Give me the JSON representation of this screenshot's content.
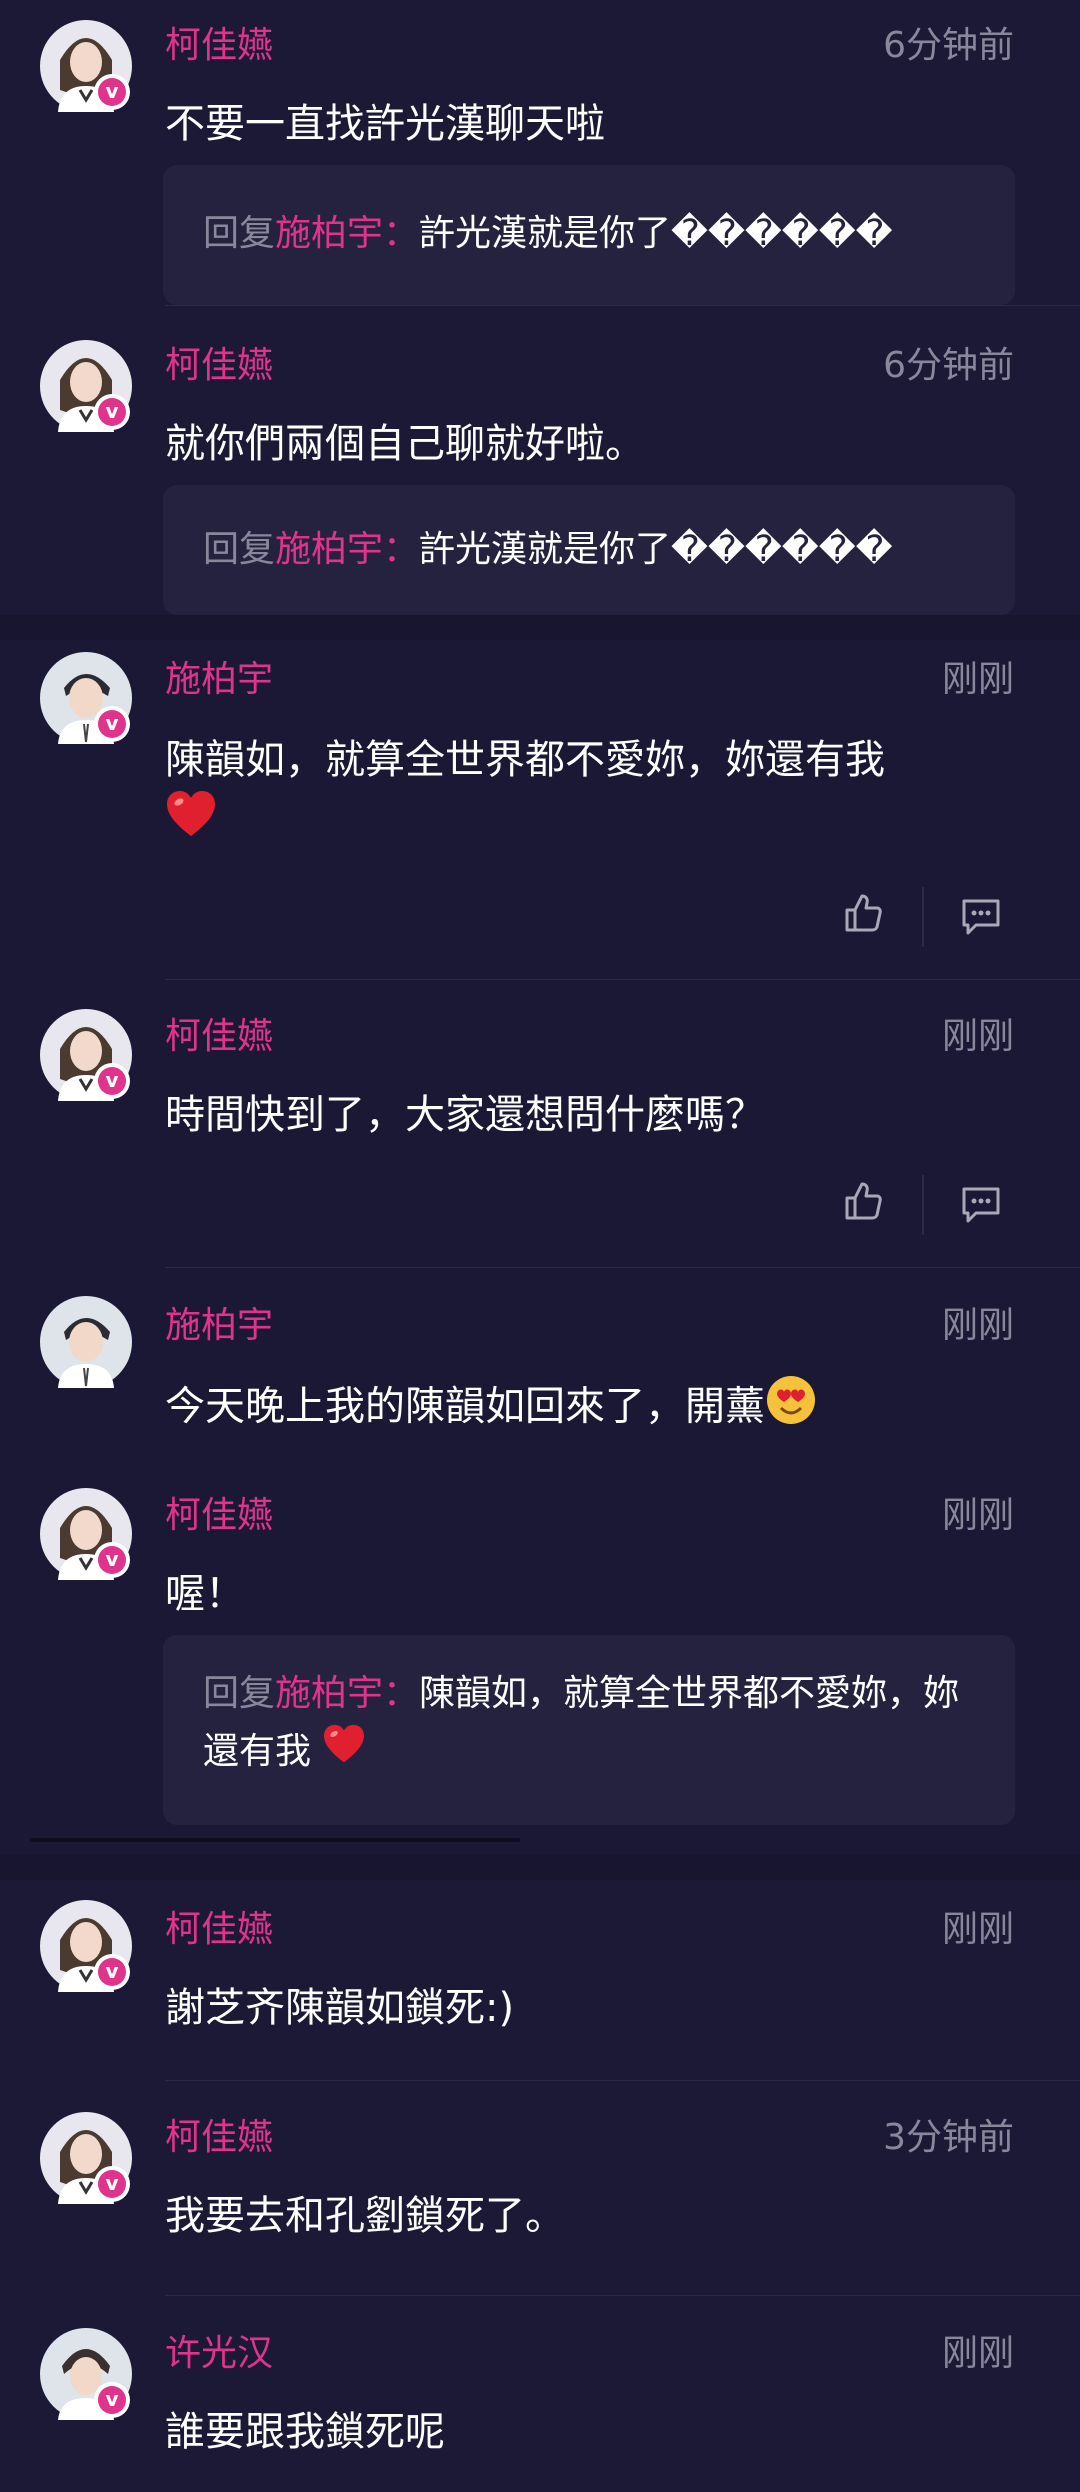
{
  "comments": [
    {
      "user": "柯佳嬿",
      "time": "6分钟前",
      "text": "不要一直找許光漢聊天啦",
      "reply": {
        "prefix": "回复",
        "name": "施柏宇：",
        "text": "許光漢就是你了������"
      }
    },
    {
      "user": "柯佳嬿",
      "time": "6分钟前",
      "text": "就你們兩個自己聊就好啦。",
      "reply": {
        "prefix": "回复",
        "name": "施柏宇：",
        "text": "許光漢就是你了������"
      }
    },
    {
      "user": "施柏宇",
      "time": "刚刚",
      "text": "陳韻如，就算全世界都不愛妳，妳還有我"
    },
    {
      "user": "柯佳嬿",
      "time": "刚刚",
      "text": "時間快到了，大家還想問什麼嗎？"
    },
    {
      "user": "施柏宇",
      "time": "刚刚",
      "text": "今天晚上我的陳韻如回來了，開薰"
    },
    {
      "user": "柯佳嬿",
      "time": "刚刚",
      "text": "喔！",
      "reply": {
        "prefix": "回复",
        "name": "施柏宇：",
        "text": "陳韻如，就算全世界都不愛妳，妳還有我"
      }
    },
    {
      "user": "柯佳嬿",
      "time": "刚刚",
      "text": "謝芝齐陳韻如鎖死:)"
    },
    {
      "user": "柯佳嬿",
      "time": "3分钟前",
      "text": "我要去和孔劉鎖死了。"
    },
    {
      "user": "许光汉",
      "time": "刚刚",
      "text": "誰要跟我鎖死呢"
    }
  ],
  "badge": "v",
  "colors": {
    "accent": "#e0338c",
    "background": "#181530",
    "muted": "#8a879c"
  },
  "icons": [
    "verified-badge-icon",
    "heart-emoji-icon",
    "like-icon",
    "comment-icon",
    "heart-eyes-emoji-icon"
  ]
}
